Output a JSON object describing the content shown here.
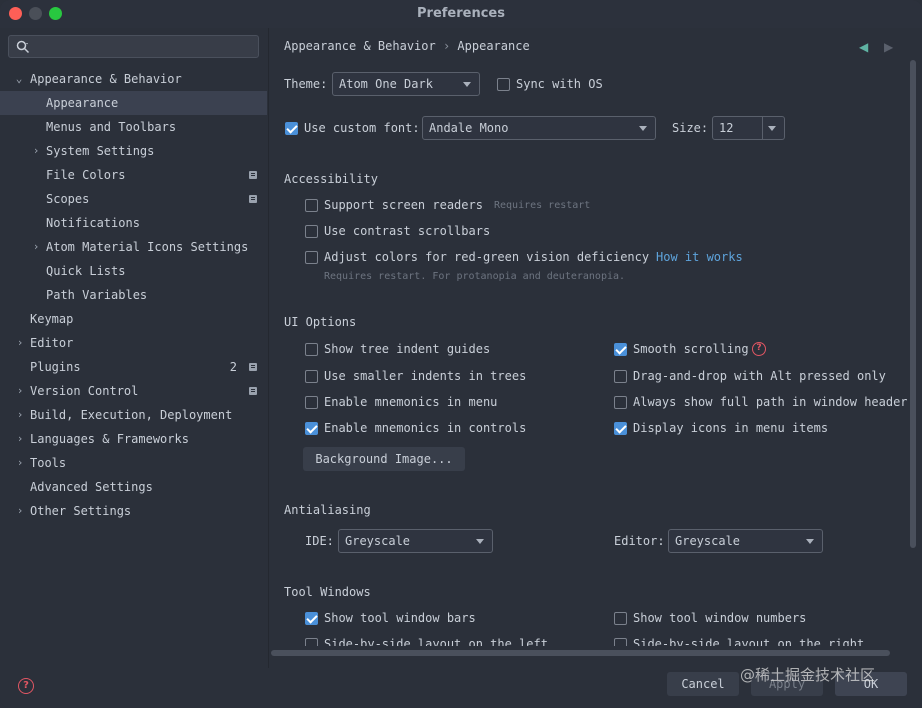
{
  "window": {
    "title": "Preferences"
  },
  "sidebar": {
    "search_placeholder": "",
    "items": [
      {
        "label": "Appearance & Behavior"
      },
      {
        "label": "Appearance"
      },
      {
        "label": "Menus and Toolbars"
      },
      {
        "label": "System Settings"
      },
      {
        "label": "File Colors"
      },
      {
        "label": "Scopes"
      },
      {
        "label": "Notifications"
      },
      {
        "label": "Atom Material Icons Settings"
      },
      {
        "label": "Quick Lists"
      },
      {
        "label": "Path Variables"
      },
      {
        "label": "Keymap"
      },
      {
        "label": "Editor"
      },
      {
        "label": "Plugins",
        "count": "2"
      },
      {
        "label": "Version Control"
      },
      {
        "label": "Build, Execution, Deployment"
      },
      {
        "label": "Languages & Frameworks"
      },
      {
        "label": "Tools"
      },
      {
        "label": "Advanced Settings"
      },
      {
        "label": "Other Settings"
      }
    ]
  },
  "breadcrumb": {
    "parent": "Appearance & Behavior",
    "separator": "›",
    "current": "Appearance"
  },
  "theme": {
    "label": "Theme:",
    "value": "Atom One Dark",
    "sync_label": "Sync with OS",
    "sync_checked": false
  },
  "font": {
    "use_custom_label": "Use custom font:",
    "use_custom_checked": true,
    "value": "Andale Mono",
    "size_label": "Size:",
    "size_value": "12"
  },
  "accessibility": {
    "heading": "Accessibility",
    "screen_readers": "Support screen readers",
    "screen_readers_hint": "Requires restart",
    "contrast_scrollbars": "Use contrast scrollbars",
    "adjust_colors": "Adjust colors for red-green vision deficiency",
    "how_it_works": "How it works",
    "adjust_hint": "Requires restart. For protanopia and deuteranopia."
  },
  "ui_options": {
    "heading": "UI Options",
    "tree_indent": "Show tree indent guides",
    "smaller_indents": "Use smaller indents in trees",
    "mnemonics_menu": "Enable mnemonics in menu",
    "mnemonics_controls": "Enable mnemonics in controls",
    "smooth_scrolling": "Smooth scrolling",
    "drag_drop": "Drag-and-drop with Alt pressed only",
    "full_path": "Always show full path in window header",
    "display_icons": "Display icons in menu items",
    "background_image": "Background Image..."
  },
  "antialiasing": {
    "heading": "Antialiasing",
    "ide_label": "IDE:",
    "ide_value": "Greyscale",
    "editor_label": "Editor:",
    "editor_value": "Greyscale"
  },
  "tool_windows": {
    "heading": "Tool Windows",
    "show_bars": "Show tool window bars",
    "show_numbers": "Show tool window numbers",
    "side_left": "Side-by-side layout on the left",
    "side_right": "Side-by-side layout on the right"
  },
  "buttons": {
    "cancel": "Cancel",
    "apply": "Apply",
    "ok": "OK"
  },
  "watermark": "@稀土掘金技术社区",
  "colors": {
    "accent": "#4a90d9",
    "link": "#5ea4dc",
    "help": "#e05663",
    "selected_bg": "#3b4150"
  }
}
